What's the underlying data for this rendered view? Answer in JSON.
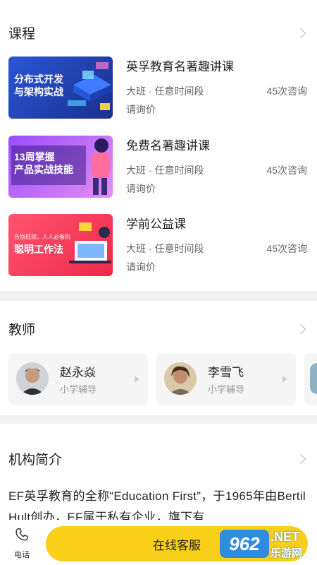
{
  "courses": {
    "title": "课程",
    "items": [
      {
        "title": "英孚教育名著趣讲课",
        "thumb_text": "分布式开发\n与架构实战",
        "meta": "大班 · 任意时间段",
        "count": "45次咨询",
        "price": "请询价"
      },
      {
        "title": "免费名著趣讲课",
        "thumb_text": "13周掌握\n产品实战技能",
        "meta": "大班 · 任意时间段",
        "count": "45次咨询",
        "price": "请询价"
      },
      {
        "title": "学前公益课",
        "thumb_small": "告别低效，人人必备的",
        "thumb_text": "聪明工作法",
        "meta": "大班 · 任意时间段",
        "count": "45次咨询",
        "price": "请询价"
      }
    ]
  },
  "teachers": {
    "title": "教师",
    "items": [
      {
        "name": "赵永焱",
        "role": "小学辅导"
      },
      {
        "name": "李雪飞",
        "role": "小学辅导"
      }
    ]
  },
  "intro": {
    "title": "机构简介",
    "text": "EF英孚教育的全称“Education First”，于1965年由Bertil Hult创办，EF属于私有企业，旗下有"
  },
  "bottom": {
    "phone_label": "电话",
    "service_label": "在线客服"
  },
  "watermark": {
    "logo": "962",
    "net": ".NET",
    "cn": "乐游网"
  },
  "colors": {
    "accent": "#f9cf1a",
    "thumb1": "#1e3fae",
    "thumb2": "#7a3cf0",
    "thumb3": "#f0405c"
  }
}
